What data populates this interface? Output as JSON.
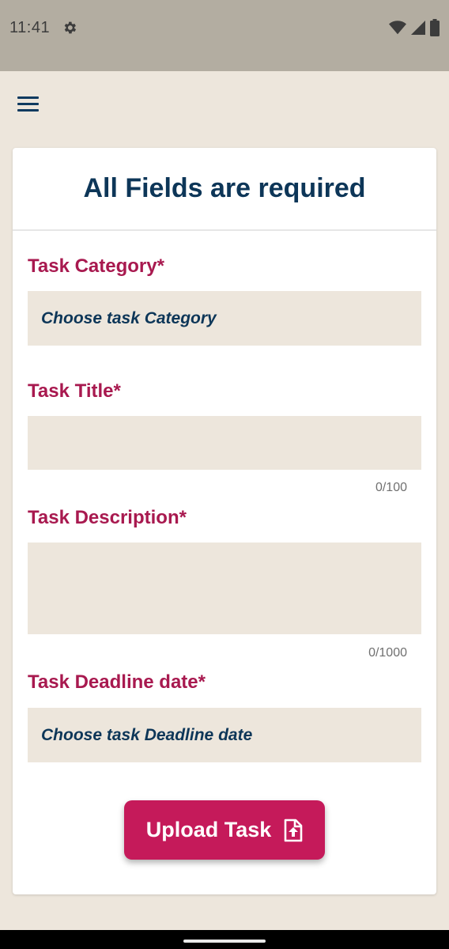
{
  "status_bar": {
    "time": "11:41",
    "icons": [
      "gear-icon",
      "wifi-icon",
      "signal-icon",
      "battery-icon"
    ]
  },
  "toolbar": {
    "menu_icon": "hamburger-menu-icon"
  },
  "form": {
    "header_title": "All Fields are required",
    "category": {
      "label": "Task Category*",
      "placeholder": "Choose task Category"
    },
    "title": {
      "label": "Task Title*",
      "value": "",
      "counter": "0/100"
    },
    "description": {
      "label": "Task Description*",
      "value": "",
      "counter": "0/1000"
    },
    "deadline": {
      "label": "Task Deadline date*",
      "placeholder": "Choose task Deadline date"
    },
    "submit_label": "Upload Task",
    "submit_icon": "file-upload-icon"
  },
  "colors": {
    "status_bar_bg": "#b3ada1",
    "background": "#ede6dc",
    "title_navy": "#0d3658",
    "label_crimson": "#a8194f",
    "button_bg": "#c51a5a"
  }
}
